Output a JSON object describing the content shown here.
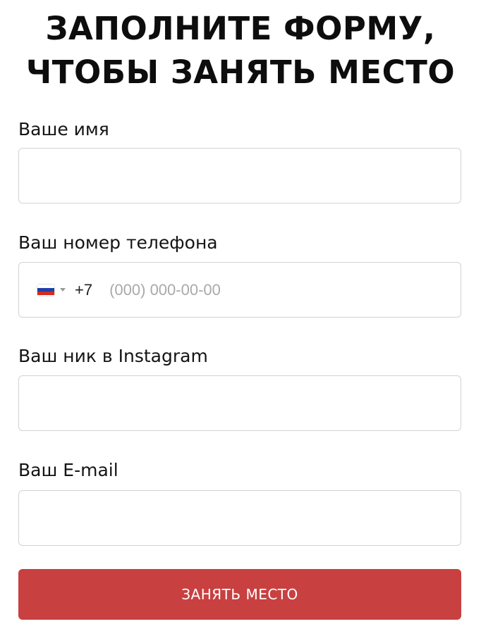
{
  "form": {
    "title_line1": "ЗАПОЛНИТЕ ФОРМУ,",
    "title_line2": "ЧТОБЫ ЗАНЯТЬ МЕСТО",
    "name": {
      "label": "Ваше имя",
      "value": ""
    },
    "phone": {
      "label": "Ваш номер телефона",
      "country_icon": "russia-flag-icon",
      "dial_code": "+7",
      "placeholder": "(000) 000-00-00",
      "value": ""
    },
    "instagram": {
      "label": "Ваш ник в Instagram",
      "value": ""
    },
    "email": {
      "label": "Ваш E-mail",
      "value": ""
    },
    "submit_label": "ЗАНЯТЬ МЕСТО"
  },
  "colors": {
    "accent": "#c84040",
    "border": "#d3d3d3",
    "placeholder": "#a9a9a9"
  }
}
